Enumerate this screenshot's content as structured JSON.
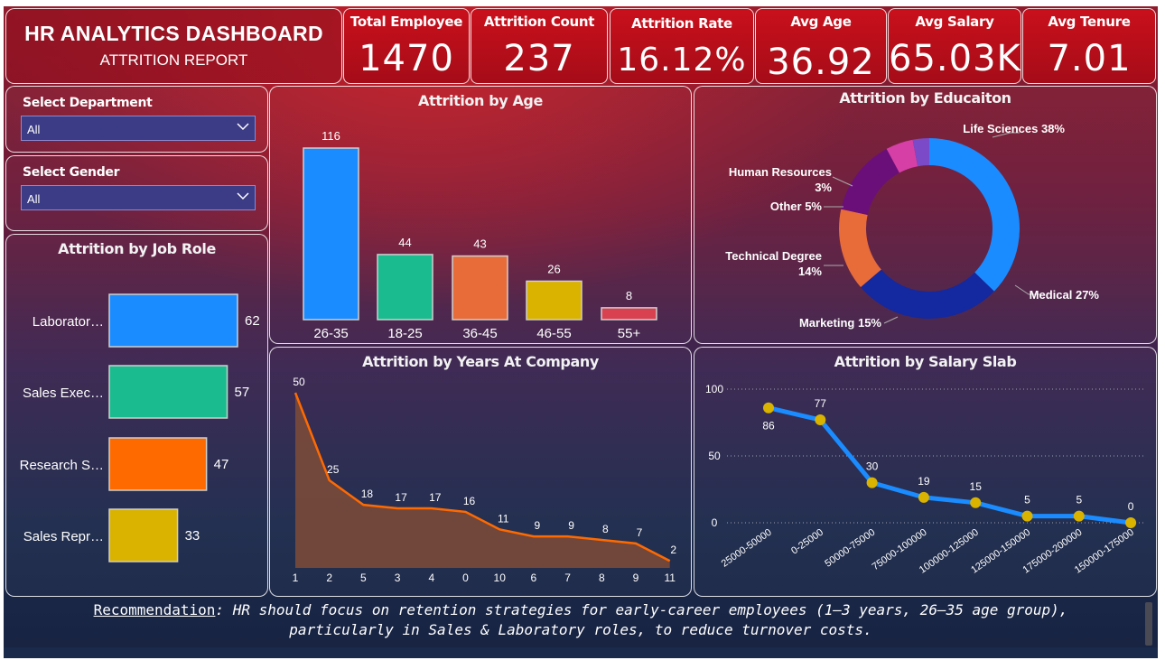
{
  "header": {
    "title": "HR ANALYTICS DASHBOARD",
    "subtitle": "ATTRITION REPORT"
  },
  "kpis": [
    {
      "label": "Total Employee",
      "value": "1470"
    },
    {
      "label": "Attrition Count",
      "value": "237"
    },
    {
      "label": "Attrition Rate",
      "value": "16.12%"
    },
    {
      "label": "Avg Age",
      "value": "36.92"
    },
    {
      "label": "Avg Salary",
      "value": "65.03K"
    },
    {
      "label": "Avg Tenure",
      "value": "7.01"
    }
  ],
  "filters": {
    "department": {
      "label": "Select Department",
      "value": "All"
    },
    "gender": {
      "label": "Select Gender",
      "value": "All"
    }
  },
  "colors": {
    "blue": "#1a8cff",
    "teal": "#1abc8f",
    "orange": "#e86b3a",
    "yellow": "#d9b300",
    "red": "#d94050",
    "area": "#7a4a3a",
    "line": "#ff6a00",
    "navy": "#1428a0",
    "purple": "#6a0f7a",
    "pink": "#d63fa6",
    "violet": "#7a4ac9",
    "salary_line": "#1a8cff",
    "salary_dot": "#d9b300"
  },
  "chart_data": [
    {
      "type": "bar",
      "title": "Attrition by Age",
      "categories": [
        "26-35",
        "18-25",
        "36-45",
        "46-55",
        "55+"
      ],
      "values": [
        116,
        44,
        43,
        26,
        8
      ],
      "colors": [
        "#1a8cff",
        "#1abc8f",
        "#e86b3a",
        "#d9b300",
        "#d94050"
      ]
    },
    {
      "type": "pie",
      "title": "Attrition by Educaiton",
      "slices": [
        {
          "label": "Life Sciences",
          "value": 38,
          "text": "Life Sciences 38%",
          "color": "#1a8cff"
        },
        {
          "label": "Medical",
          "value": 27,
          "text": "Medical 27%",
          "color": "#1428a0"
        },
        {
          "label": "Marketing",
          "value": 15,
          "text": "Marketing 15%",
          "color": "#e86b3a"
        },
        {
          "label": "Technical Degree",
          "value": 14,
          "text": "Technical Degree",
          "text2": "14%",
          "color": "#6a0f7a"
        },
        {
          "label": "Other",
          "value": 5,
          "text": "Other 5%",
          "color": "#d63fa6"
        },
        {
          "label": "Human Resources",
          "value": 3,
          "text": "Human Resources",
          "text2": "3%",
          "color": "#7a4ac9"
        }
      ]
    },
    {
      "type": "bar",
      "orientation": "horizontal",
      "title": "Attrition by Job Role",
      "categories": [
        "Laborator…",
        "Sales Exec…",
        "Research S…",
        "Sales Repr…"
      ],
      "values": [
        62,
        57,
        47,
        33
      ],
      "colors": [
        "#1a8cff",
        "#1abc8f",
        "#ff6a00",
        "#d9b300"
      ]
    },
    {
      "type": "area",
      "title": "Attrition by Years At Company",
      "categories": [
        "1",
        "2",
        "5",
        "3",
        "4",
        "0",
        "10",
        "6",
        "7",
        "8",
        "9",
        "11"
      ],
      "values": [
        50,
        25,
        18,
        17,
        17,
        16,
        11,
        9,
        9,
        8,
        7,
        2
      ]
    },
    {
      "type": "line",
      "title": "Attrition by Salary Slab",
      "categories": [
        "25000-50000",
        "0-25000",
        "50000-75000",
        "75000-100000",
        "100000-125000",
        "125000-150000",
        "175000-200000",
        "150000-175000"
      ],
      "values": [
        86,
        77,
        30,
        19,
        15,
        5,
        5,
        0
      ],
      "yticks": [
        "0",
        "50",
        "100"
      ],
      "ylim": [
        0,
        100
      ]
    }
  ],
  "recommendation": {
    "label": "Recommendation",
    "line1": ": HR should focus on retention strategies for early-career employees (1–3 years, 26–35 age group),",
    "line2": "particularly in Sales & Laboratory roles, to reduce turnover costs."
  }
}
